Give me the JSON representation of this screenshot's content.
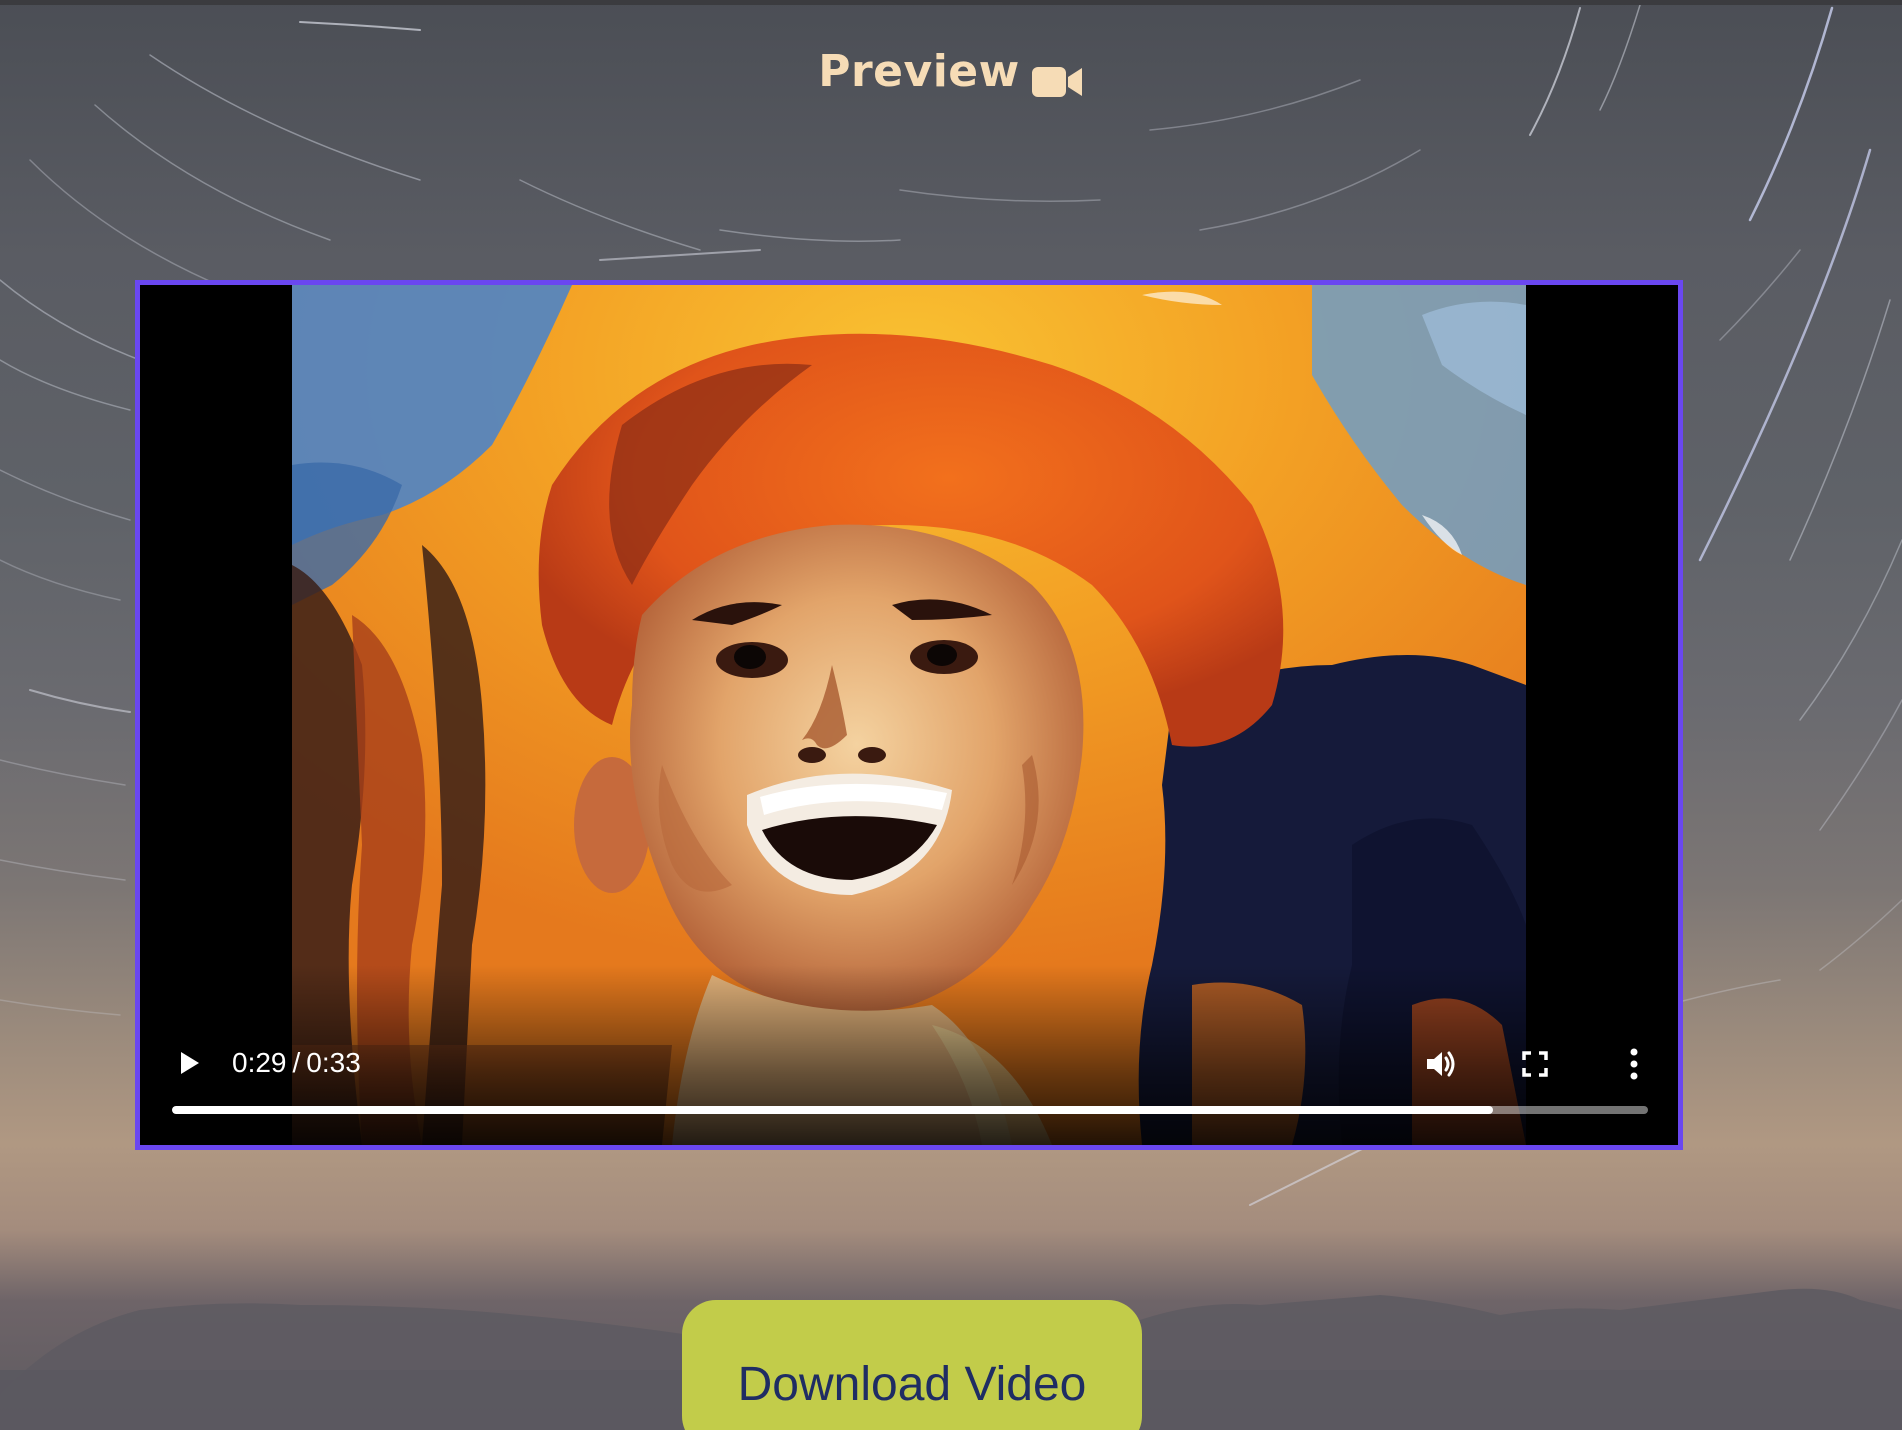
{
  "header": {
    "title": "Preview",
    "icon": "video-camera-icon",
    "title_color": "#f6dcb6"
  },
  "player": {
    "border_color": "#6a47f0",
    "current_time": "0:29",
    "time_separator": "/",
    "duration": "0:33",
    "progress_fraction": 0.895,
    "play_icon": "play-icon",
    "volume_icon": "volume-icon",
    "fullscreen_icon": "fullscreen-icon",
    "more_icon": "more-options-icon"
  },
  "actions": {
    "download_label": "Download Video",
    "download_bg": "#c2cc4a",
    "download_text_color": "#1f2d63"
  }
}
